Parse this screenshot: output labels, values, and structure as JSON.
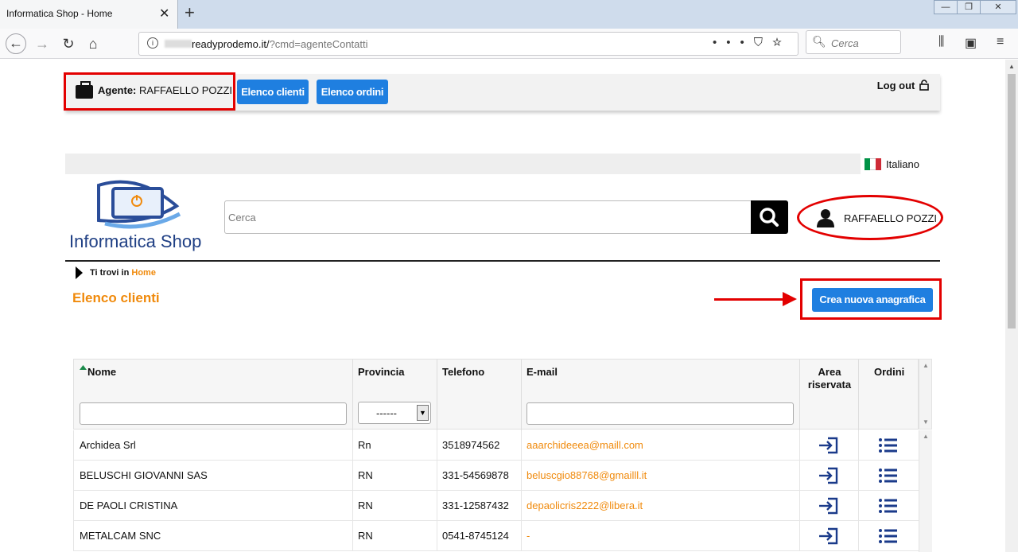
{
  "browser": {
    "tab_title": "Informatica Shop - Home",
    "url_host": "readyprodemo.it/",
    "url_path": "?cmd=agenteContatti",
    "search_placeholder": "Cerca"
  },
  "agent": {
    "label": "Agente:",
    "name": "RAFFAELLO POZZI",
    "btn_clienti": "Elenco clienti",
    "btn_ordini": "Elenco ordini",
    "logout": "Log out"
  },
  "lang": {
    "label": "Italiano"
  },
  "header": {
    "logo_text": "Informatica Shop",
    "search_placeholder": "Cerca",
    "user_name": "RAFFAELLO POZZI"
  },
  "breadcrumb": {
    "prefix": "Ti trovi in",
    "link": "Home"
  },
  "main": {
    "title": "Elenco clienti",
    "create_button": "Crea nuova anagrafica"
  },
  "table": {
    "headers": {
      "nome": "Nome",
      "provincia": "Provincia",
      "telefono": "Telefono",
      "email": "E-mail",
      "area1": "Area",
      "area2": "riservata",
      "ordini": "Ordini"
    },
    "provincia_select": "------",
    "rows": [
      {
        "nome": "Archidea Srl",
        "provincia": "Rn",
        "telefono": "3518974562",
        "email": "aaarchideeea@maill.com"
      },
      {
        "nome": "BELUSCHI GIOVANNI SAS",
        "provincia": "RN",
        "telefono": "331-54569878",
        "email": "beluscgio88768@gmailll.it"
      },
      {
        "nome": "DE PAOLI CRISTINA",
        "provincia": "RN",
        "telefono": "331-12587432",
        "email": "depaolicris2222@libera.it"
      },
      {
        "nome": "METALCAM SNC",
        "provincia": "RN",
        "telefono": "0541-8745124",
        "email": "-"
      }
    ]
  },
  "colors": {
    "accent_blue": "#1f7fe0",
    "orange": "#f08a0c",
    "highlight_red": "#e30000",
    "icon_navy": "#1a3a8a"
  }
}
